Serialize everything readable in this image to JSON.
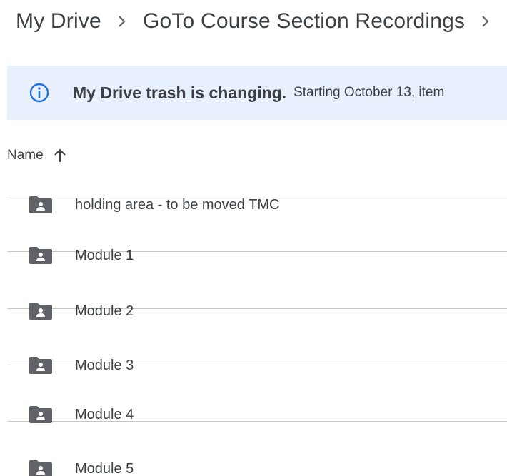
{
  "breadcrumb": {
    "items": [
      "My Drive",
      "GoTo Course Section Recordings"
    ],
    "separator_icon": "chevron-right-icon"
  },
  "banner": {
    "icon": "info-icon",
    "title": "My Drive trash is changing.",
    "text": "Starting October 13, item",
    "colors": {
      "background": "#e8f0fe",
      "icon": "#1a73e8"
    }
  },
  "list_header": {
    "name_label": "Name",
    "sort_icon": "arrow-up-icon"
  },
  "files": [
    {
      "name": "holding area - to be moved TMC",
      "icon": "shared-folder-icon"
    },
    {
      "name": "Module 1",
      "icon": "shared-folder-icon"
    },
    {
      "name": "Module 2",
      "icon": "shared-folder-icon"
    },
    {
      "name": "Module 3",
      "icon": "shared-folder-icon"
    },
    {
      "name": "Module 4",
      "icon": "shared-folder-icon"
    },
    {
      "name": "Module 5",
      "icon": "shared-folder-icon"
    }
  ]
}
